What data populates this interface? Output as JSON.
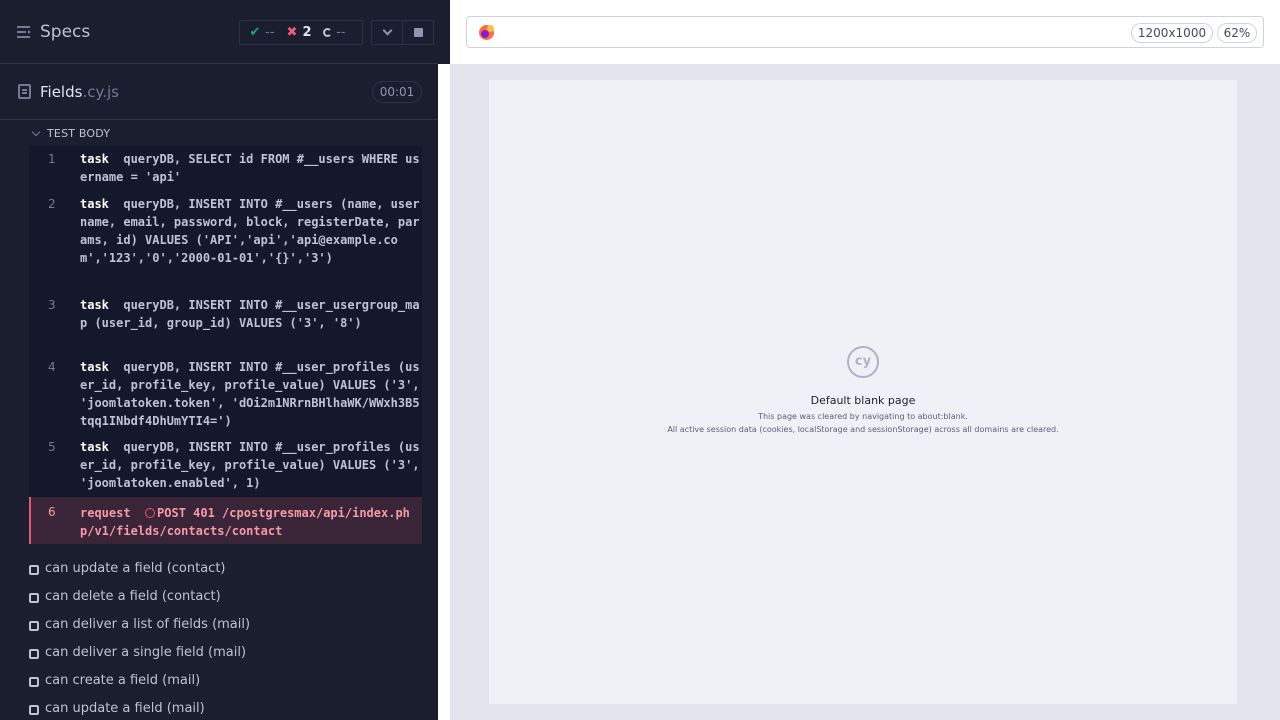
{
  "reporter": {
    "title": "Specs",
    "stats": {
      "passed": "--",
      "failed": "2",
      "pending": "--"
    },
    "file": {
      "name": "Fields",
      "ext": ".cy.js",
      "duration": "00:01"
    },
    "section": "TEST BODY",
    "commands": [
      {
        "num": "1",
        "name": "task",
        "message": "queryDB, SELECT id FROM #__users WHERE username = 'api'"
      },
      {
        "num": "2",
        "name": "task",
        "message": "queryDB, INSERT INTO #__users (name, username, email, password, block, registerDate, params, id) VALUES ('API','api','api@example.com','123','0','2000-01-01','{}','3')"
      },
      {
        "num": "3",
        "name": "task",
        "message": "queryDB, INSERT INTO #__user_usergroup_map (user_id, group_id) VALUES ('3', '8')"
      },
      {
        "num": "4",
        "name": "task",
        "message": "queryDB, INSERT INTO #__user_profiles (user_id, profile_key, profile_value) VALUES ('3', 'joomlatoken.token', 'dOi2m1NRrnBHlhaWK/WWxh3B5tqq1INbdf4DhUmYTI4=')"
      },
      {
        "num": "5",
        "name": "task",
        "message": "queryDB, INSERT INTO #__user_profiles (user_id, profile_key, profile_value) VALUES ('3', 'joomlatoken.enabled', 1)"
      },
      {
        "num": "6",
        "name": "request",
        "message": "POST 401 /cpostgresmax/api/index.php/v1/fields/contacts/contact"
      }
    ],
    "tests": [
      "can update a field (contact)",
      "can delete a field (contact)",
      "can deliver a list of fields (mail)",
      "can deliver a single field (mail)",
      "can create a field (mail)",
      "can update a field (mail)"
    ]
  },
  "aut": {
    "viewport_size": "1200x1000",
    "zoom": "62%",
    "blank_title": "Default blank page",
    "blank_line1": "This page was cleared by navigating to about:blank.",
    "blank_line2": "All active session data (cookies, localStorage and sessionStorage) across all domains are cleared.",
    "logo_text": "cy"
  },
  "colors": {
    "pass": "#1fa971",
    "fail": "#f05978",
    "failed_row_bg": "#3a2538"
  }
}
